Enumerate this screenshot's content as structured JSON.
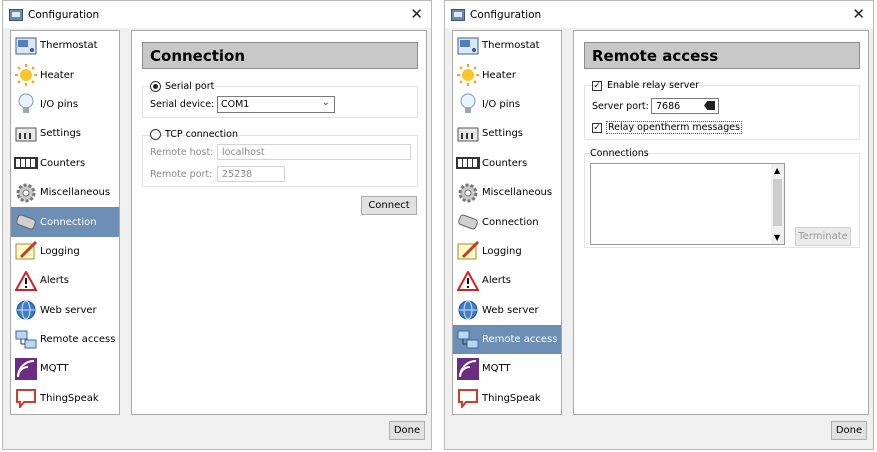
{
  "window_title": "Configuration",
  "sidebar_items": [
    "Thermostat",
    "Heater",
    "I/O pins",
    "Settings",
    "Counters",
    "Miscellaneous",
    "Connection",
    "Logging",
    "Alerts",
    "Web server",
    "Remote access",
    "MQTT",
    "ThingSpeak"
  ],
  "left": {
    "selected": "Connection",
    "header": "Connection",
    "serial_radio": "Serial port",
    "serial_device_label": "Serial device:",
    "serial_device_value": "COM1",
    "tcp_radio": "TCP connection",
    "remote_host_label": "Remote host:",
    "remote_host_value": "localhost",
    "remote_port_label": "Remote port:",
    "remote_port_value": "25238",
    "connect_button": "Connect",
    "done_button": "Done"
  },
  "right": {
    "selected": "Remote access",
    "header": "Remote access",
    "enable_relay": "Enable relay server",
    "server_port_label": "Server port:",
    "server_port_value": "7686",
    "relay_messages": "Relay opentherm messages",
    "connections_label": "Connections",
    "terminate_button": "Terminate",
    "done_button": "Done"
  },
  "colors": {
    "selection": "#6d8fb6",
    "header_bg": "#c8c8c8"
  }
}
